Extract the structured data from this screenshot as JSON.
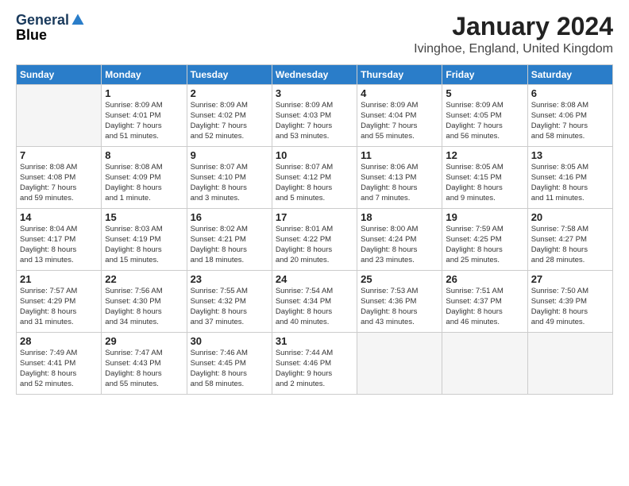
{
  "header": {
    "logo_general": "General",
    "logo_blue": "Blue",
    "month_title": "January 2024",
    "location": "Ivinghoe, England, United Kingdom"
  },
  "columns": [
    "Sunday",
    "Monday",
    "Tuesday",
    "Wednesday",
    "Thursday",
    "Friday",
    "Saturday"
  ],
  "weeks": [
    [
      {
        "day": "",
        "info": ""
      },
      {
        "day": "1",
        "info": "Sunrise: 8:09 AM\nSunset: 4:01 PM\nDaylight: 7 hours\nand 51 minutes."
      },
      {
        "day": "2",
        "info": "Sunrise: 8:09 AM\nSunset: 4:02 PM\nDaylight: 7 hours\nand 52 minutes."
      },
      {
        "day": "3",
        "info": "Sunrise: 8:09 AM\nSunset: 4:03 PM\nDaylight: 7 hours\nand 53 minutes."
      },
      {
        "day": "4",
        "info": "Sunrise: 8:09 AM\nSunset: 4:04 PM\nDaylight: 7 hours\nand 55 minutes."
      },
      {
        "day": "5",
        "info": "Sunrise: 8:09 AM\nSunset: 4:05 PM\nDaylight: 7 hours\nand 56 minutes."
      },
      {
        "day": "6",
        "info": "Sunrise: 8:08 AM\nSunset: 4:06 PM\nDaylight: 7 hours\nand 58 minutes."
      }
    ],
    [
      {
        "day": "7",
        "info": "Sunrise: 8:08 AM\nSunset: 4:08 PM\nDaylight: 7 hours\nand 59 minutes."
      },
      {
        "day": "8",
        "info": "Sunrise: 8:08 AM\nSunset: 4:09 PM\nDaylight: 8 hours\nand 1 minute."
      },
      {
        "day": "9",
        "info": "Sunrise: 8:07 AM\nSunset: 4:10 PM\nDaylight: 8 hours\nand 3 minutes."
      },
      {
        "day": "10",
        "info": "Sunrise: 8:07 AM\nSunset: 4:12 PM\nDaylight: 8 hours\nand 5 minutes."
      },
      {
        "day": "11",
        "info": "Sunrise: 8:06 AM\nSunset: 4:13 PM\nDaylight: 8 hours\nand 7 minutes."
      },
      {
        "day": "12",
        "info": "Sunrise: 8:05 AM\nSunset: 4:15 PM\nDaylight: 8 hours\nand 9 minutes."
      },
      {
        "day": "13",
        "info": "Sunrise: 8:05 AM\nSunset: 4:16 PM\nDaylight: 8 hours\nand 11 minutes."
      }
    ],
    [
      {
        "day": "14",
        "info": "Sunrise: 8:04 AM\nSunset: 4:17 PM\nDaylight: 8 hours\nand 13 minutes."
      },
      {
        "day": "15",
        "info": "Sunrise: 8:03 AM\nSunset: 4:19 PM\nDaylight: 8 hours\nand 15 minutes."
      },
      {
        "day": "16",
        "info": "Sunrise: 8:02 AM\nSunset: 4:21 PM\nDaylight: 8 hours\nand 18 minutes."
      },
      {
        "day": "17",
        "info": "Sunrise: 8:01 AM\nSunset: 4:22 PM\nDaylight: 8 hours\nand 20 minutes."
      },
      {
        "day": "18",
        "info": "Sunrise: 8:00 AM\nSunset: 4:24 PM\nDaylight: 8 hours\nand 23 minutes."
      },
      {
        "day": "19",
        "info": "Sunrise: 7:59 AM\nSunset: 4:25 PM\nDaylight: 8 hours\nand 25 minutes."
      },
      {
        "day": "20",
        "info": "Sunrise: 7:58 AM\nSunset: 4:27 PM\nDaylight: 8 hours\nand 28 minutes."
      }
    ],
    [
      {
        "day": "21",
        "info": "Sunrise: 7:57 AM\nSunset: 4:29 PM\nDaylight: 8 hours\nand 31 minutes."
      },
      {
        "day": "22",
        "info": "Sunrise: 7:56 AM\nSunset: 4:30 PM\nDaylight: 8 hours\nand 34 minutes."
      },
      {
        "day": "23",
        "info": "Sunrise: 7:55 AM\nSunset: 4:32 PM\nDaylight: 8 hours\nand 37 minutes."
      },
      {
        "day": "24",
        "info": "Sunrise: 7:54 AM\nSunset: 4:34 PM\nDaylight: 8 hours\nand 40 minutes."
      },
      {
        "day": "25",
        "info": "Sunrise: 7:53 AM\nSunset: 4:36 PM\nDaylight: 8 hours\nand 43 minutes."
      },
      {
        "day": "26",
        "info": "Sunrise: 7:51 AM\nSunset: 4:37 PM\nDaylight: 8 hours\nand 46 minutes."
      },
      {
        "day": "27",
        "info": "Sunrise: 7:50 AM\nSunset: 4:39 PM\nDaylight: 8 hours\nand 49 minutes."
      }
    ],
    [
      {
        "day": "28",
        "info": "Sunrise: 7:49 AM\nSunset: 4:41 PM\nDaylight: 8 hours\nand 52 minutes."
      },
      {
        "day": "29",
        "info": "Sunrise: 7:47 AM\nSunset: 4:43 PM\nDaylight: 8 hours\nand 55 minutes."
      },
      {
        "day": "30",
        "info": "Sunrise: 7:46 AM\nSunset: 4:45 PM\nDaylight: 8 hours\nand 58 minutes."
      },
      {
        "day": "31",
        "info": "Sunrise: 7:44 AM\nSunset: 4:46 PM\nDaylight: 9 hours\nand 2 minutes."
      },
      {
        "day": "",
        "info": ""
      },
      {
        "day": "",
        "info": ""
      },
      {
        "day": "",
        "info": ""
      }
    ]
  ]
}
